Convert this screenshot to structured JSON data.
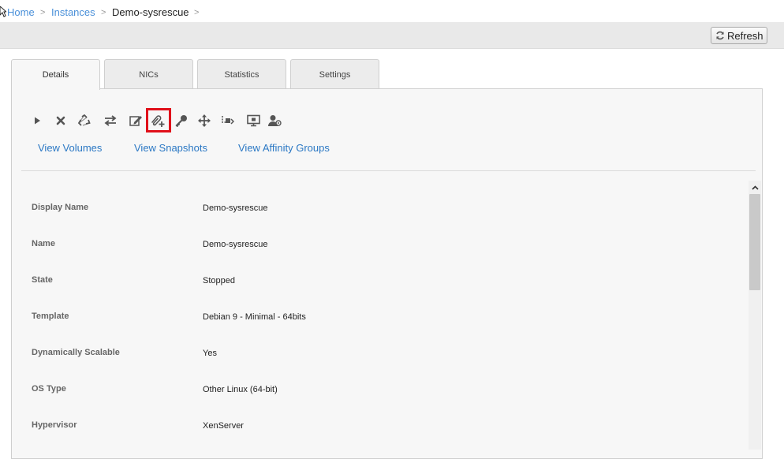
{
  "breadcrumb": {
    "home": "Home",
    "instances": "Instances",
    "current": "Demo-sysrescue",
    "separator": ">"
  },
  "toolbar": {
    "refresh_label": "Refresh"
  },
  "tabs": [
    {
      "label": "Details",
      "active": true
    },
    {
      "label": "NICs",
      "active": false
    },
    {
      "label": "Statistics",
      "active": false
    },
    {
      "label": "Settings",
      "active": false
    }
  ],
  "actions": [
    "start-icon",
    "destroy-icon",
    "recycle-icon",
    "migrate-icon",
    "edit-icon",
    "attach-iso-icon",
    "reset-ssh-key-icon",
    "move-icon",
    "scale-icon",
    "console-icon",
    "assign-user-icon"
  ],
  "links": {
    "volumes": "View Volumes",
    "snapshots": "View Snapshots",
    "affinity_groups": "View Affinity Groups"
  },
  "details": [
    {
      "label": "Display Name",
      "value": "Demo-sysrescue"
    },
    {
      "label": "Name",
      "value": "Demo-sysrescue"
    },
    {
      "label": "State",
      "value": "Stopped"
    },
    {
      "label": "Template",
      "value": "Debian 9 - Minimal - 64bits"
    },
    {
      "label": "Dynamically Scalable",
      "value": "Yes"
    },
    {
      "label": "OS Type",
      "value": "Other Linux (64-bit)"
    },
    {
      "label": "Hypervisor",
      "value": "XenServer"
    }
  ],
  "colors": {
    "link": "#2b78c4",
    "highlight": "#e0101a",
    "icon": "#555555"
  }
}
